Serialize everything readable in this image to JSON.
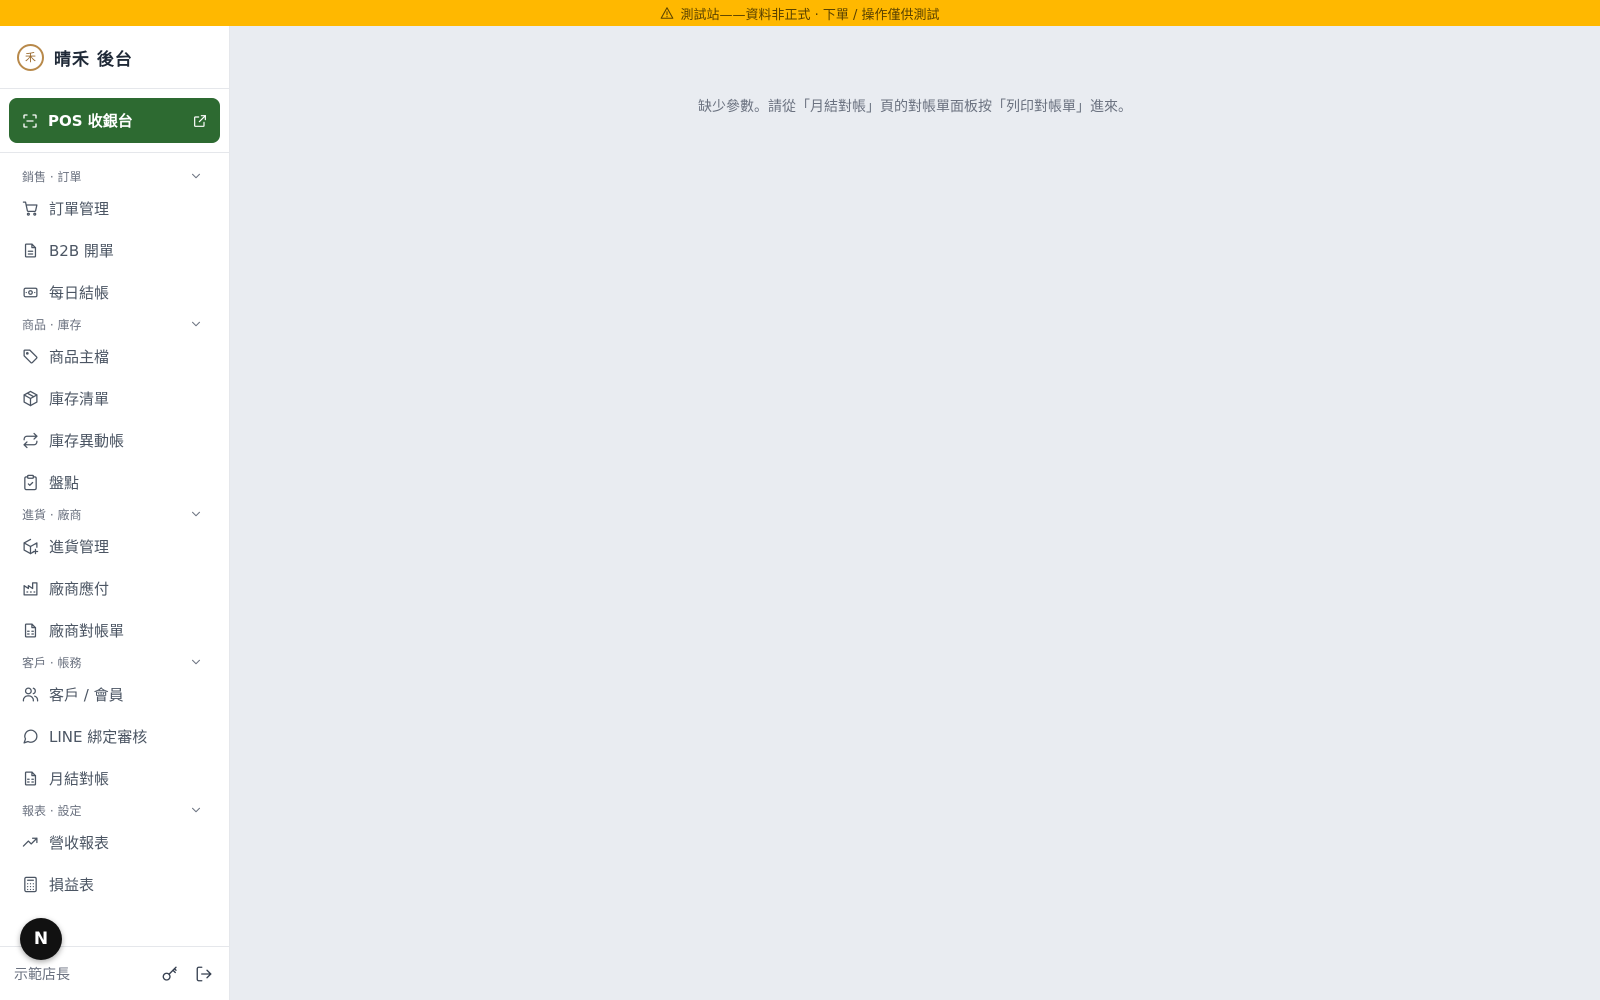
{
  "banner": {
    "text": "測試站——資料非正式 · 下單 / 操作僅供測試",
    "icon": "warning-icon",
    "color": "#ffb800"
  },
  "brand": {
    "logo_glyph": "禾",
    "title": "晴禾 後台"
  },
  "pos": {
    "label": "POS 收銀台",
    "color": "#2d6a31"
  },
  "nav": {
    "groups": [
      {
        "title": "銷售 · 訂單",
        "items": [
          {
            "label": "訂單管理",
            "icon": "cart-icon"
          },
          {
            "label": "B2B 開單",
            "icon": "document-icon"
          },
          {
            "label": "每日結帳",
            "icon": "cash-icon"
          }
        ]
      },
      {
        "title": "商品 · 庫存",
        "items": [
          {
            "label": "商品主檔",
            "icon": "tag-icon"
          },
          {
            "label": "庫存清單",
            "icon": "box-icon"
          },
          {
            "label": "庫存異動帳",
            "icon": "repeat-icon"
          },
          {
            "label": "盤點",
            "icon": "clipboard-check-icon"
          }
        ]
      },
      {
        "title": "進貨 · 廠商",
        "items": [
          {
            "label": "進貨管理",
            "icon": "package-plus-icon"
          },
          {
            "label": "廠商應付",
            "icon": "factory-icon"
          },
          {
            "label": "廠商對帳單",
            "icon": "spreadsheet-icon"
          }
        ]
      },
      {
        "title": "客戶 · 帳務",
        "items": [
          {
            "label": "客戶 / 會員",
            "icon": "users-icon"
          },
          {
            "label": "LINE 綁定審核",
            "icon": "chat-icon"
          },
          {
            "label": "月結對帳",
            "icon": "spreadsheet-icon"
          }
        ]
      },
      {
        "title": "報表 · 設定",
        "items": [
          {
            "label": "營收報表",
            "icon": "trending-up-icon"
          },
          {
            "label": "損益表",
            "icon": "calculator-icon"
          }
        ]
      }
    ]
  },
  "footer": {
    "user": "示範店長"
  },
  "badge": {
    "letter": "N"
  },
  "main": {
    "message": "缺少參數。請從「月結對帳」頁的對帳單面板按「列印對帳單」進來。"
  }
}
